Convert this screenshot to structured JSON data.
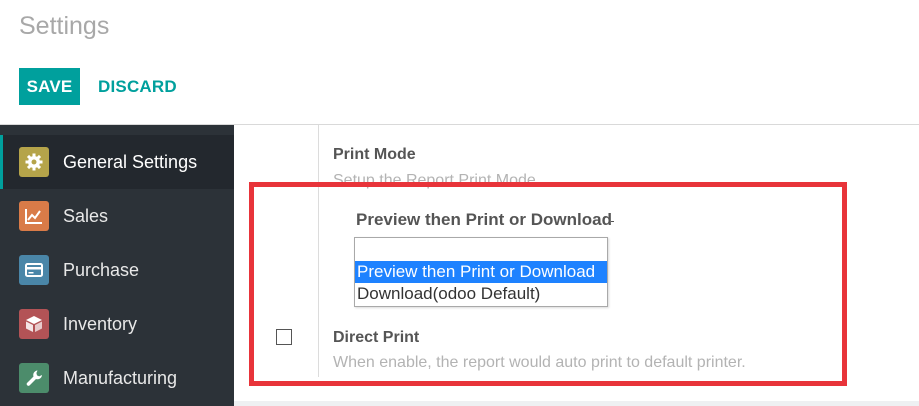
{
  "page": {
    "title": "Settings"
  },
  "toolbar": {
    "save_label": "SAVE",
    "discard_label": "DISCARD"
  },
  "sidebar": {
    "items": [
      {
        "label": "General Settings",
        "icon": "gear-icon",
        "color": "#b5a44a",
        "active": true
      },
      {
        "label": "Sales",
        "icon": "chart-icon",
        "color": "#d97b48",
        "active": false
      },
      {
        "label": "Purchase",
        "icon": "credit-card-icon",
        "color": "#4a86a8",
        "active": false
      },
      {
        "label": "Inventory",
        "icon": "box-icon",
        "color": "#b35356",
        "active": false
      },
      {
        "label": "Manufacturing",
        "icon": "wrench-icon",
        "color": "#4c8c6b",
        "active": false
      }
    ]
  },
  "print_mode": {
    "title": "Print Mode",
    "description": "Setup the Report Print Mode.",
    "selected": "Preview then Print or Download",
    "search_value": "",
    "options": [
      {
        "label": "Preview then Print or Download",
        "selected": true
      },
      {
        "label": "Download(odoo Default)",
        "selected": false
      }
    ]
  },
  "direct_print": {
    "title": "Direct Print",
    "description": "When enable, the report would auto print to default printer.",
    "checked": false
  },
  "colors": {
    "accent": "#00a09d",
    "highlight": "#e8343a",
    "sidebar_bg": "#2c3238",
    "selection": "#1e82ff"
  }
}
